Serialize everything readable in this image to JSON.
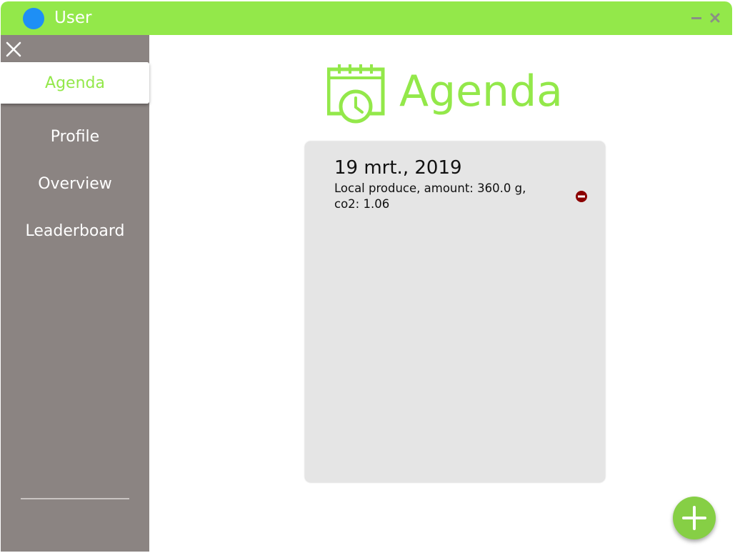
{
  "window": {
    "title": "User"
  },
  "colors": {
    "accent": "#93e84a",
    "sidebar_bg": "#8b8482",
    "card_bg": "#e5e5e5",
    "app_icon": "#1e8ff5",
    "remove_icon": "#8b0000",
    "fab": "#86cf45"
  },
  "icons": {
    "minimize": "minimize-icon",
    "close": "close-icon",
    "sidebar_close": "close-x-icon",
    "header": "calendar-clock-icon",
    "remove": "remove-circle-icon",
    "add": "plus-icon"
  },
  "sidebar": {
    "items": [
      {
        "label": "Agenda",
        "active": true
      },
      {
        "label": "Profile",
        "active": false
      },
      {
        "label": "Overview",
        "active": false
      },
      {
        "label": "Leaderboard",
        "active": false
      }
    ]
  },
  "main": {
    "title": "Agenda",
    "entries": [
      {
        "date": "19 mrt., 2019",
        "description": "Local produce, amount: 360.0 g, co2: 1.06"
      }
    ]
  }
}
